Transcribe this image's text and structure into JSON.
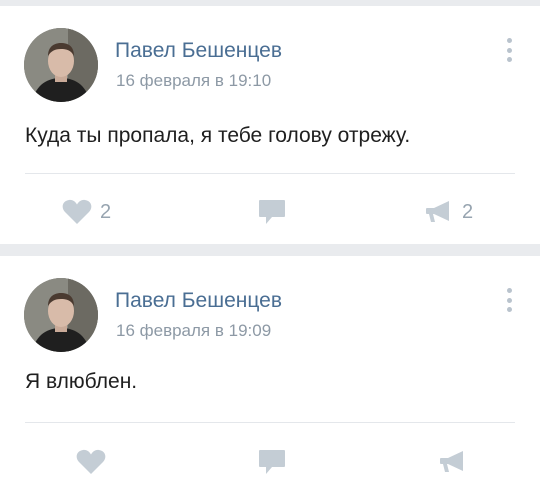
{
  "posts": [
    {
      "author": "Павел Бешенцев",
      "date": "16 февраля в 19:10",
      "text": "Куда ты пропала, я тебе голову отрежу.",
      "likes": "2",
      "shares": "2",
      "icons": {
        "like": "heart-icon",
        "comment": "comment-icon",
        "share": "megaphone-icon",
        "menu": "more-vertical-icon"
      }
    },
    {
      "author": "Павел Бешенцев",
      "date": "16 февраля в 19:09",
      "text": "Я влюблен.",
      "icons": {
        "like": "heart-icon",
        "comment": "comment-icon",
        "share": "megaphone-icon",
        "menu": "more-vertical-icon"
      }
    }
  ],
  "colors": {
    "background": "#e9ebee",
    "card": "#ffffff",
    "author": "#4a6e93",
    "date": "#8d99a5",
    "icon": "#c4cdd5",
    "count": "#97a4b0"
  }
}
